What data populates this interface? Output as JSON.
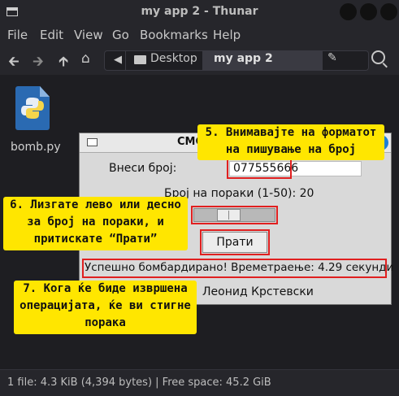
{
  "window": {
    "title": "my app 2 - Thunar"
  },
  "menu": [
    "File",
    "Edit",
    "View",
    "Go",
    "Bookmarks",
    "Help"
  ],
  "location": {
    "parent": "Desktop",
    "current": "my app 2"
  },
  "files": [
    {
      "name": "bomb.py",
      "icon": "python-file-icon"
    }
  ],
  "status": {
    "text": "1 file: 4.3 KiB (4,394 bytes)  |  Free space: 45.2 GiB"
  },
  "dialog": {
    "title": "СМС Бо",
    "phone_label": "Внеси број:",
    "phone_value": "077555666",
    "count_label": "Број на пораки (1-50): 20",
    "slider": {
      "value": 20,
      "min": 1,
      "max": 50
    },
    "send_button": "Прати",
    "result": "Успешно бомбардирано! Времетраење: 4.29 секунди",
    "author": "Леонид Крстевски"
  },
  "annotations": {
    "note5": [
      "5. Внимавајте на форматот",
      "на пишување на број"
    ],
    "note6": [
      "6. Лизгате лево или десно",
      "за број на пораки, и",
      "притискате “Прати”"
    ],
    "note7": [
      "7. Кога ќе биде извршена",
      "операцијата, ќе ви стигне",
      "порака"
    ]
  },
  "colors": {
    "annotation_bg": "#ffe600",
    "highlight_border": "#e02020",
    "close_button": "#1c7fd6"
  }
}
